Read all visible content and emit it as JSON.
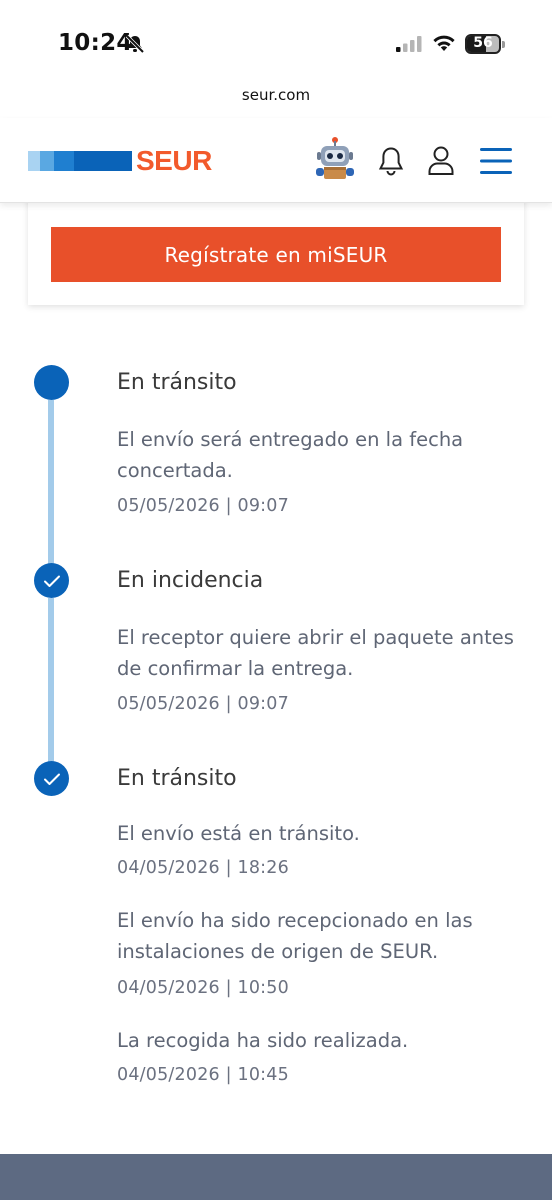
{
  "status_bar": {
    "time": "10:24",
    "battery": "56"
  },
  "browser": {
    "url": "seur.com"
  },
  "header": {
    "logo_text": "SEUR",
    "icons": [
      "robot-assistant-icon",
      "bell-icon",
      "user-icon",
      "menu-icon"
    ]
  },
  "cta": {
    "register_label": "Regístrate en miSEUR"
  },
  "colors": {
    "brand_orange": "#e8502a",
    "brand_blue": "#0a63b8",
    "timeline_line": "#a3cbea",
    "footer": "#5d6a82"
  },
  "timeline": [
    {
      "title": "En tránsito",
      "status": "current",
      "entries": [
        {
          "text": "El envío será entregado en la fecha concertada.",
          "date": "05/05/2026 | 09:07"
        }
      ]
    },
    {
      "title": "En incidencia",
      "status": "completed",
      "entries": [
        {
          "text": "El receptor quiere abrir el paquete antes de confirmar la entrega.",
          "date": "05/05/2026 | 09:07"
        }
      ]
    },
    {
      "title": "En tránsito",
      "status": "completed",
      "entries": [
        {
          "text": "El envío está en tránsito.",
          "date": "04/05/2026 | 18:26"
        },
        {
          "text": "El envío ha sido recepcionado en las instalaciones de origen de SEUR.",
          "date": "04/05/2026 | 10:50"
        },
        {
          "text": "La recogida ha sido realizada.",
          "date": "04/05/2026 | 10:45"
        }
      ]
    }
  ]
}
